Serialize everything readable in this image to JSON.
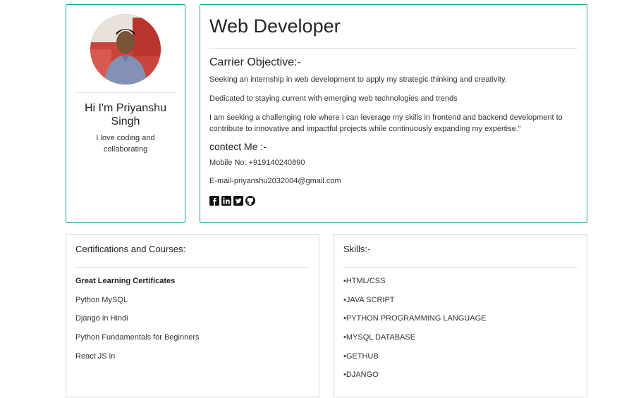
{
  "profile": {
    "name": "Hi I'm Priyanshu Singh",
    "tagline": "I love coding and collaborating",
    "avatar_icon": "person-photo"
  },
  "main": {
    "role": "Web Developer",
    "objective_heading": "Carrier Objective:-",
    "objectives": [
      "Seeking an internship in web development to apply my strategic thinking and creativity.",
      "Dedicated to staying current with emerging web technologies and trends",
      "I am seeking a challenging role where I can leverage my skills in frontend and backend development to contribute to innovative and impactful projects while continuously expanding my expertise.\""
    ],
    "contact_heading": "contect Me :-",
    "mobile": "Mobile No: +919140240890",
    "email": "E-mail-priyanshu2032004@gmail.com",
    "social_icons": [
      "facebook-icon",
      "linkedin-icon",
      "twitter-icon",
      "github-icon"
    ]
  },
  "certs": {
    "title": "Certifications and Courses:",
    "items": [
      "Great Learning Certificates",
      "Python MySQL",
      "Django in Hindi",
      "Python Fundamentals for Beginners",
      "React JS in"
    ]
  },
  "skills": {
    "title": "Skills:-",
    "items": [
      "•HTML/CSS",
      "•JAVA SCRIPT",
      "•PYTHON PROGRAMMING LANGUAGE",
      "•MYSQL DATABASE",
      "•GETHUB",
      "•DJANGO"
    ]
  },
  "colors": {
    "accent_border": "#1d9aa6",
    "card_border": "#d9d9d9"
  }
}
